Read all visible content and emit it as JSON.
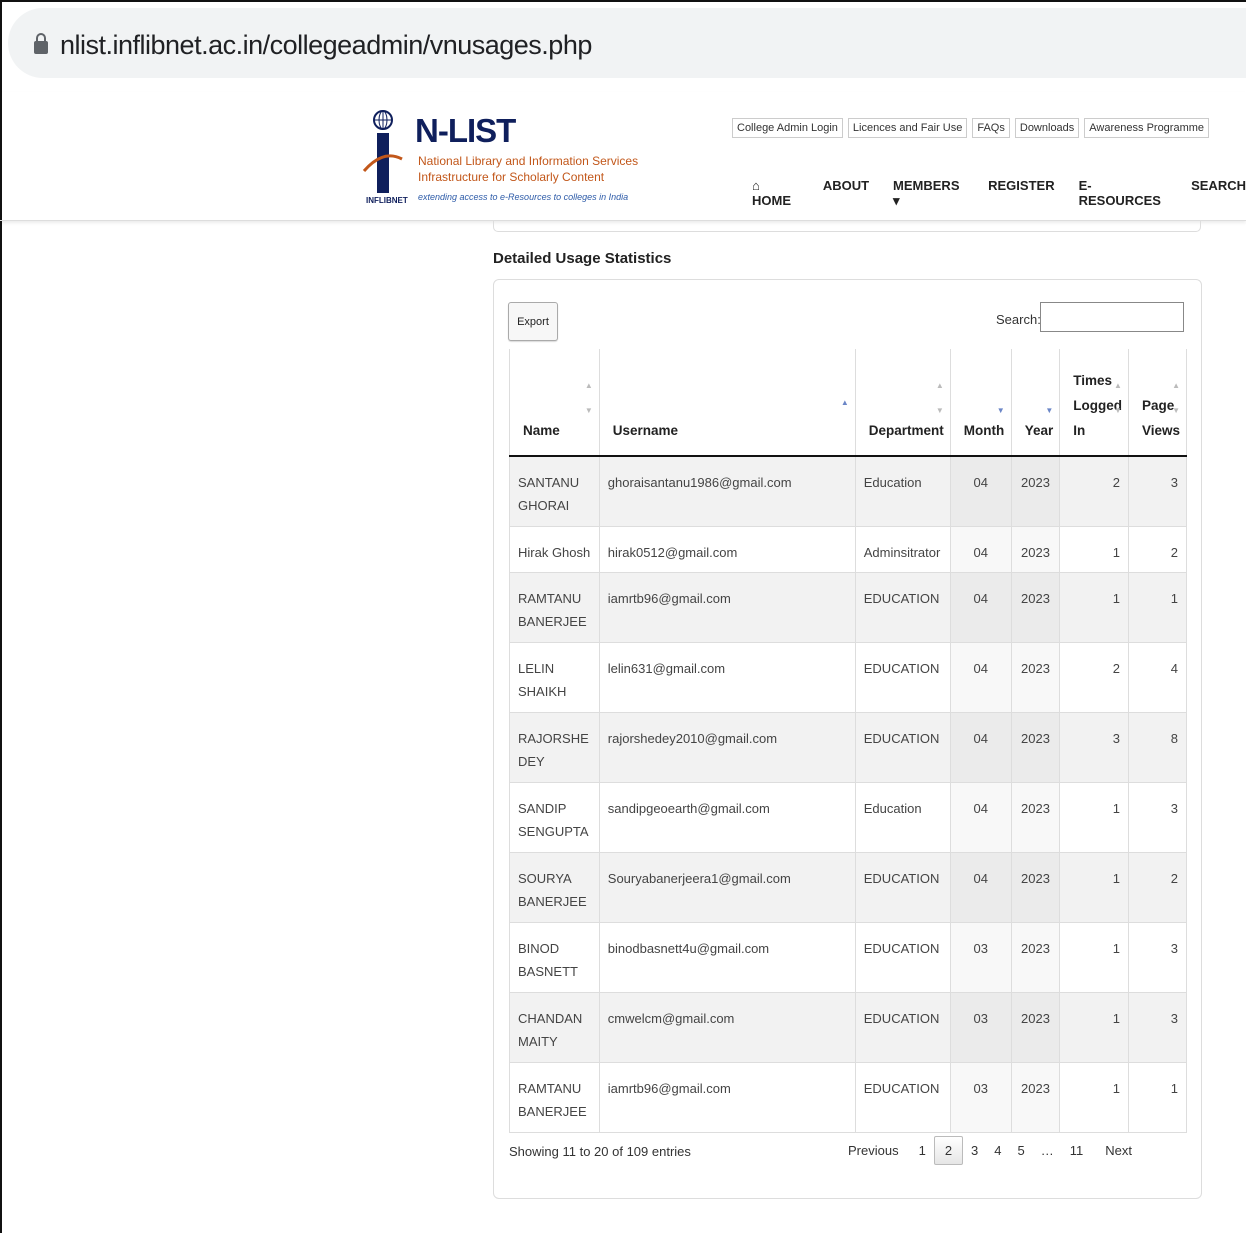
{
  "browser": {
    "url": "nlist.inflibnet.ac.in/collegeadmin/vnusages.php"
  },
  "header": {
    "logo_title": "N-LIST",
    "logo_sub1": "National Library and Information Services",
    "logo_sub2": "Infrastructure for Scholarly Content",
    "logo_tagline": "extending access to e-Resources to colleges in India",
    "logo_org": "INFLIBNET",
    "top_links": [
      "College Admin Login",
      "Licences and Fair Use",
      "FAQs",
      "Downloads",
      "Awareness Programme"
    ],
    "nav": [
      "⌂ HOME",
      "ABOUT",
      "MEMBERS ▾",
      "REGISTER",
      "E-RESOURCES",
      "SEARCH"
    ]
  },
  "page": {
    "title": "Detailed Usage Statistics",
    "export_label": "Export",
    "search_label": "Search:",
    "search_value": ""
  },
  "table": {
    "columns": [
      "Name",
      "Username",
      "Department",
      "Month",
      "Year",
      "Times Logged In",
      "Page Views"
    ],
    "rows": [
      [
        "SANTANU GHORAI",
        "ghoraisantanu1986@gmail.com",
        "Education",
        "04",
        "2023",
        "2",
        "3"
      ],
      [
        "Hirak Ghosh",
        "hirak0512@gmail.com",
        "Adminsitrator",
        "04",
        "2023",
        "1",
        "2"
      ],
      [
        "RAMTANU BANERJEE",
        "iamrtb96@gmail.com",
        "EDUCATION",
        "04",
        "2023",
        "1",
        "1"
      ],
      [
        "LELIN SHAIKH",
        "lelin631@gmail.com",
        "EDUCATION",
        "04",
        "2023",
        "2",
        "4"
      ],
      [
        "RAJORSHE DEY",
        "rajorshedey2010@gmail.com",
        "EDUCATION",
        "04",
        "2023",
        "3",
        "8"
      ],
      [
        "SANDIP SENGUPTA",
        "sandipgeoearth@gmail.com",
        "Education",
        "04",
        "2023",
        "1",
        "3"
      ],
      [
        "SOURYA BANERJEE",
        "Souryabanerjeera1@gmail.com",
        "EDUCATION",
        "04",
        "2023",
        "1",
        "2"
      ],
      [
        "BINOD BASNETT",
        "binodbasnett4u@gmail.com",
        "EDUCATION",
        "03",
        "2023",
        "1",
        "3"
      ],
      [
        "CHANDAN MAITY",
        "cmwelcm@gmail.com",
        "EDUCATION",
        "03",
        "2023",
        "1",
        "3"
      ],
      [
        "RAMTANU BANERJEE",
        "iamrtb96@gmail.com",
        "EDUCATION",
        "03",
        "2023",
        "1",
        "1"
      ]
    ]
  },
  "footer": {
    "info": "Showing 11 to 20 of 109 entries",
    "previous": "Previous",
    "pages": [
      "1",
      "2",
      "3",
      "4",
      "5",
      "…",
      "11"
    ],
    "current_page": "2",
    "next": "Next"
  }
}
